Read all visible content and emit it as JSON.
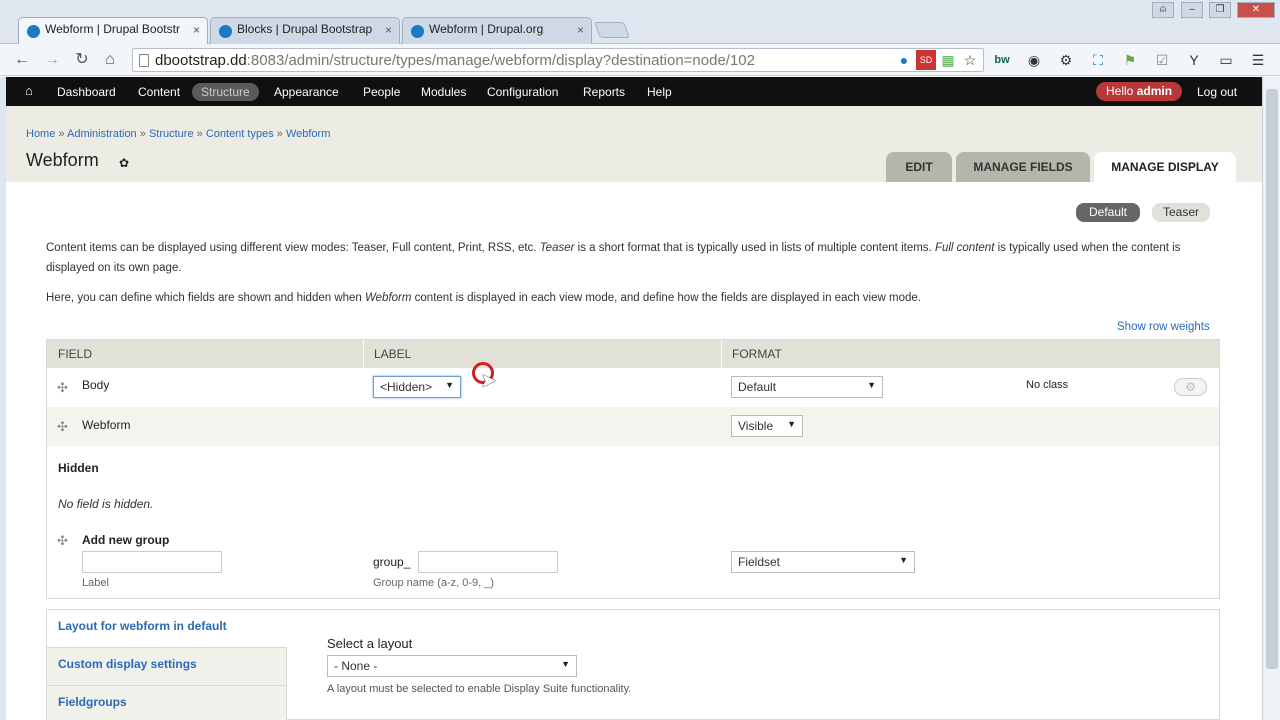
{
  "browser": {
    "tabs": [
      {
        "title": "Webform | Drupal Bootstr",
        "active": true,
        "close": "×"
      },
      {
        "title": "Blocks | Drupal Bootstrap",
        "active": false,
        "close": "×"
      },
      {
        "title": "Webform | Drupal.org",
        "active": false,
        "close": "×"
      }
    ],
    "url_host": "dbootstrap.dd",
    "url_rest": ":8083/admin/structure/types/manage/webform/display?destination=node/102"
  },
  "admin_toolbar": {
    "items": [
      "Dashboard",
      "Content",
      "Structure",
      "Appearance",
      "People",
      "Modules",
      "Configuration",
      "Reports",
      "Help"
    ],
    "active": "Structure",
    "hello_prefix": "Hello ",
    "hello_user": "admin",
    "logout": "Log out"
  },
  "breadcrumb": {
    "items": [
      "Home",
      "Administration",
      "Structure",
      "Content types",
      "Webform"
    ],
    "separator": "»"
  },
  "page": {
    "title": "Webform",
    "tabs": [
      "EDIT",
      "MANAGE FIELDS",
      "MANAGE DISPLAY"
    ],
    "active_tab": "MANAGE DISPLAY"
  },
  "view_modes": {
    "items": [
      "Default",
      "Teaser"
    ],
    "active": "Default"
  },
  "description": {
    "p1_a": "Content items can be displayed using different view modes: Teaser, Full content, Print, RSS, etc. ",
    "p1_teaser": "Teaser",
    "p1_b": " is a short format that is typically used in lists of multiple content items. ",
    "p1_full": "Full content",
    "p1_c": " is typically used when the content is displayed on its own page.",
    "p2_a": "Here, you can define which fields are shown and hidden when ",
    "p2_webform": "Webform",
    "p2_b": " content is displayed in each view mode, and define how the fields are displayed in each view mode."
  },
  "show_row_weights": "Show row weights",
  "table": {
    "headers": [
      "FIELD",
      "LABEL",
      "FORMAT"
    ],
    "rows": [
      {
        "field": "Body",
        "label": "<Hidden>",
        "format": "Default",
        "extra": "No class"
      },
      {
        "field": "Webform",
        "format": "Visible"
      }
    ],
    "hidden_title": "Hidden",
    "hidden_empty": "No field is hidden.",
    "add_group": "Add new group",
    "group_label_caption": "Label",
    "group_prefix": "group_",
    "group_name_caption": "Group name (a-z, 0-9, _)",
    "group_format": "Fieldset"
  },
  "layout": {
    "vtabs": [
      "Layout for webform in default",
      "Custom display settings",
      "Fieldgroups"
    ],
    "select_label": "Select a layout",
    "select_value": "- None -",
    "hint": "A layout must be selected to enable Display Suite functionality."
  }
}
